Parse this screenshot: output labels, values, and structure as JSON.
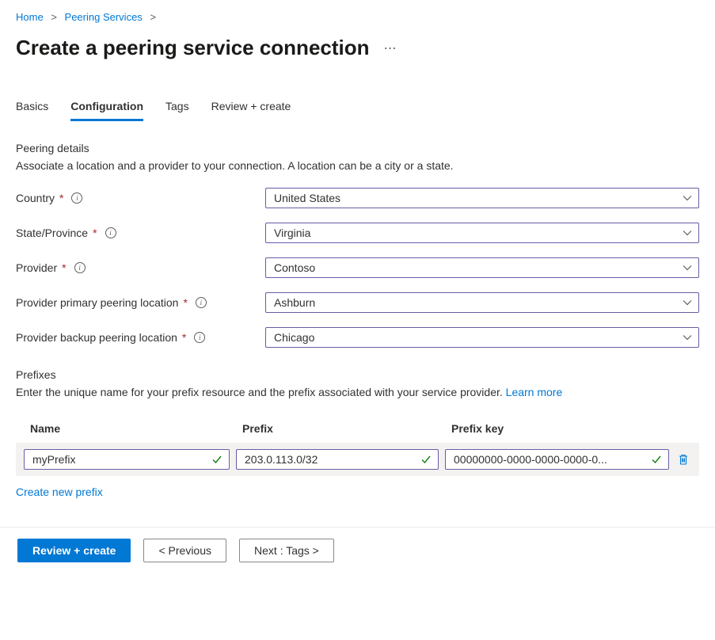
{
  "breadcrumb": {
    "items": [
      "Home",
      "Peering Services"
    ]
  },
  "title": "Create a peering service connection",
  "tabs": [
    "Basics",
    "Configuration",
    "Tags",
    "Review + create"
  ],
  "active_tab_index": 1,
  "peering_details": {
    "heading": "Peering details",
    "description": "Associate a location and a provider to your connection. A location can be a city or a state."
  },
  "form": {
    "country": {
      "label": "Country",
      "value": "United States"
    },
    "state": {
      "label": "State/Province",
      "value": "Virginia"
    },
    "provider": {
      "label": "Provider",
      "value": "Contoso"
    },
    "primary_location": {
      "label": "Provider primary peering location",
      "value": "Ashburn"
    },
    "backup_location": {
      "label": "Provider backup peering location",
      "value": "Chicago"
    }
  },
  "prefixes": {
    "heading": "Prefixes",
    "description": "Enter the unique name for your prefix resource and the prefix associated with your service provider. ",
    "learn_more": "Learn more",
    "columns": {
      "name": "Name",
      "prefix": "Prefix",
      "key": "Prefix key"
    },
    "rows": [
      {
        "name": "myPrefix",
        "prefix": "203.0.113.0/32",
        "key": "00000000-0000-0000-0000-0..."
      }
    ],
    "create_link": "Create new prefix"
  },
  "footer": {
    "review": "Review + create",
    "previous": "< Previous",
    "next": "Next : Tags >"
  }
}
